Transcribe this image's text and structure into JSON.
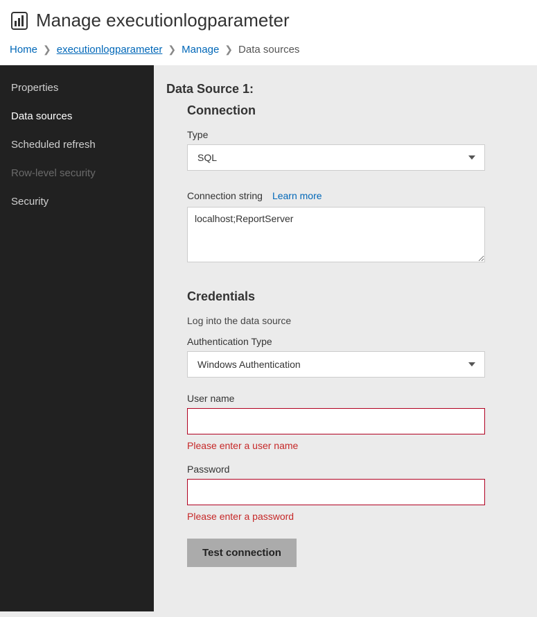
{
  "header": {
    "title": "Manage executionlogparameter"
  },
  "breadcrumb": {
    "home": "Home",
    "item": "executionlogparameter",
    "manage": "Manage",
    "current": "Data sources"
  },
  "sidebar": {
    "items": [
      {
        "label": "Properties",
        "state": "normal"
      },
      {
        "label": "Data sources",
        "state": "active"
      },
      {
        "label": "Scheduled refresh",
        "state": "normal"
      },
      {
        "label": "Row-level security",
        "state": "disabled"
      },
      {
        "label": "Security",
        "state": "normal"
      }
    ]
  },
  "main": {
    "ds_heading": "Data Source 1:",
    "connection": {
      "heading": "Connection",
      "type_label": "Type",
      "type_value": "SQL",
      "conn_string_label": "Connection string",
      "learn_more": "Learn more",
      "conn_string_value": "localhost;ReportServer"
    },
    "credentials": {
      "heading": "Credentials",
      "subtext": "Log into the data source",
      "auth_type_label": "Authentication Type",
      "auth_type_value": "Windows Authentication",
      "username_label": "User name",
      "username_value": "",
      "username_error": "Please enter a user name",
      "password_label": "Password",
      "password_value": "",
      "password_error": "Please enter a password",
      "test_button": "Test connection"
    }
  }
}
